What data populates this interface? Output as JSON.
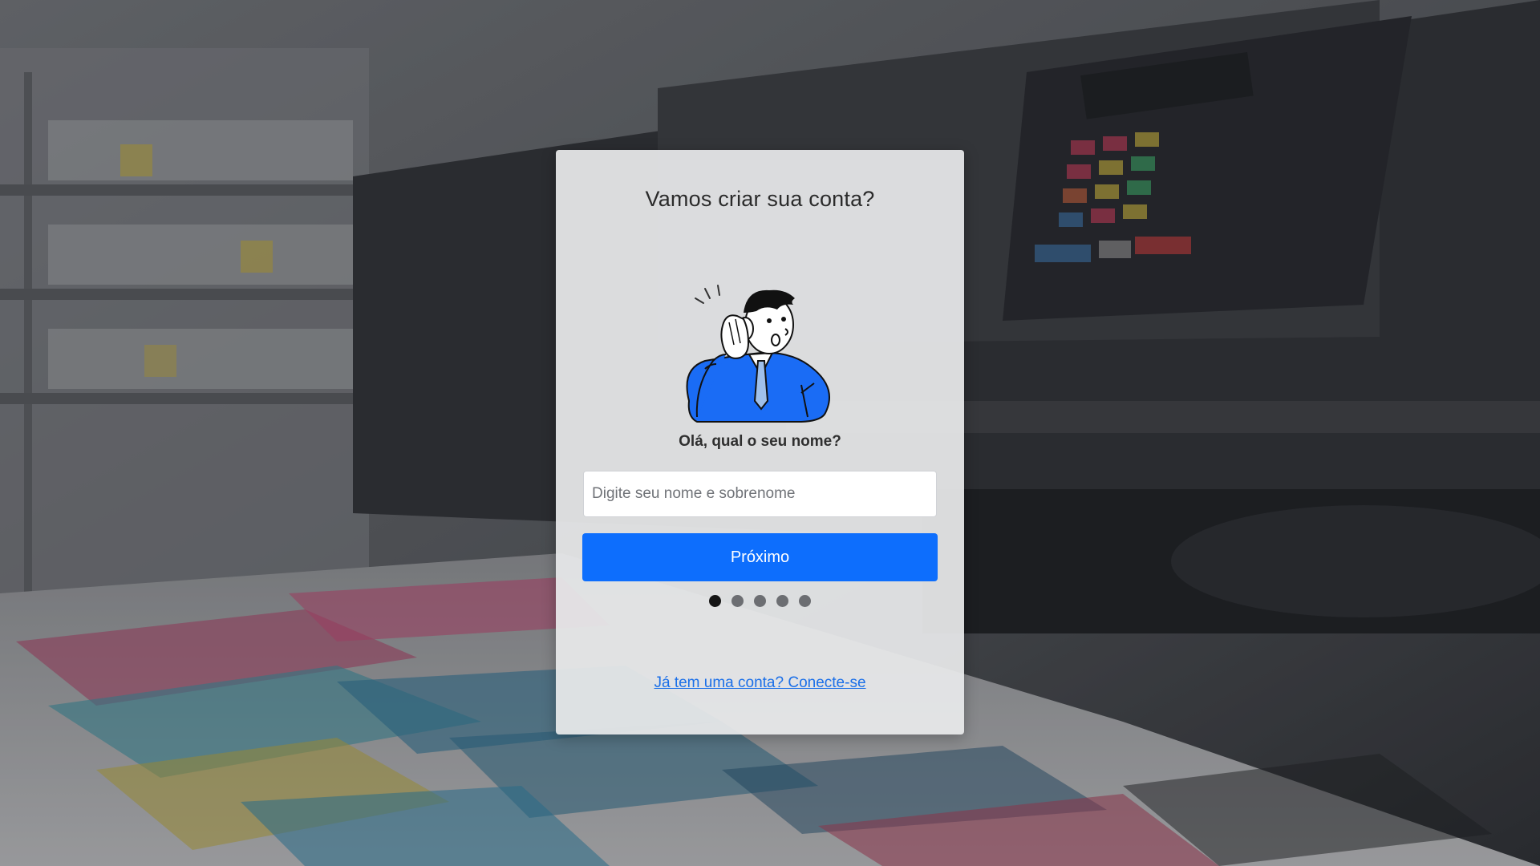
{
  "signup": {
    "title": "Vamos criar sua conta?",
    "question": "Olá, qual o seu nome?",
    "name_input": {
      "placeholder": "Digite seu nome e sobrenome",
      "value": ""
    },
    "next_label": "Próximo",
    "steps": {
      "total": 5,
      "current": 1
    },
    "login_link": "Já tem uma conta? Conecte-se"
  },
  "colors": {
    "primary": "#0d6efd",
    "link": "#1a6fe8",
    "card": "#e8e9eb",
    "dot_active": "#151515",
    "dot_inactive": "#6c6e72"
  },
  "icons": {
    "illustration": "man-listening-hand-to-ear-illustration"
  }
}
